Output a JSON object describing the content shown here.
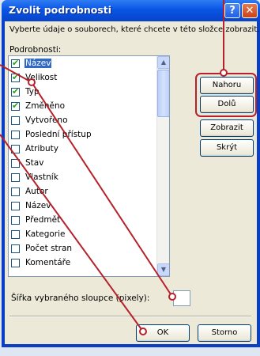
{
  "window": {
    "title": "Zvolit podrobnosti",
    "help_glyph": "?",
    "close_glyph": "✕"
  },
  "description": "Vyberte údaje o souborech, které chcete v této složce zobrazit.",
  "details_label": "Podrobnosti:",
  "details": [
    {
      "label": "Název",
      "checked": true,
      "selected": true
    },
    {
      "label": "Velikost",
      "checked": true,
      "selected": false
    },
    {
      "label": "Typ",
      "checked": true,
      "selected": false
    },
    {
      "label": "Změněno",
      "checked": true,
      "selected": false
    },
    {
      "label": "Vytvořeno",
      "checked": false,
      "selected": false
    },
    {
      "label": "Poslední přístup",
      "checked": false,
      "selected": false
    },
    {
      "label": "Atributy",
      "checked": false,
      "selected": false
    },
    {
      "label": "Stav",
      "checked": false,
      "selected": false
    },
    {
      "label": "Vlastník",
      "checked": false,
      "selected": false
    },
    {
      "label": "Autor",
      "checked": false,
      "selected": false
    },
    {
      "label": "Název",
      "checked": false,
      "selected": false
    },
    {
      "label": "Předmět",
      "checked": false,
      "selected": false
    },
    {
      "label": "Kategorie",
      "checked": false,
      "selected": false
    },
    {
      "label": "Počet stran",
      "checked": false,
      "selected": false
    },
    {
      "label": "Komentáře",
      "checked": false,
      "selected": false
    }
  ],
  "buttons": {
    "up": {
      "label": "Nahoru"
    },
    "down": {
      "label": "Dolů"
    },
    "show": {
      "label": "Zobrazit"
    },
    "hide": {
      "label": "Skrýt"
    },
    "ok": {
      "label": "OK"
    },
    "cancel": {
      "label": "Storno"
    }
  },
  "column_width": {
    "label": "Šířka vybraného sloupce (pixely):",
    "value": ""
  },
  "icons": {
    "scroll_up": "up-arrow-icon",
    "scroll_down": "down-arrow-icon"
  },
  "colors": {
    "annotation": "#b5222b",
    "selection": "#316ac5",
    "titlebar": "#0a55e4"
  }
}
